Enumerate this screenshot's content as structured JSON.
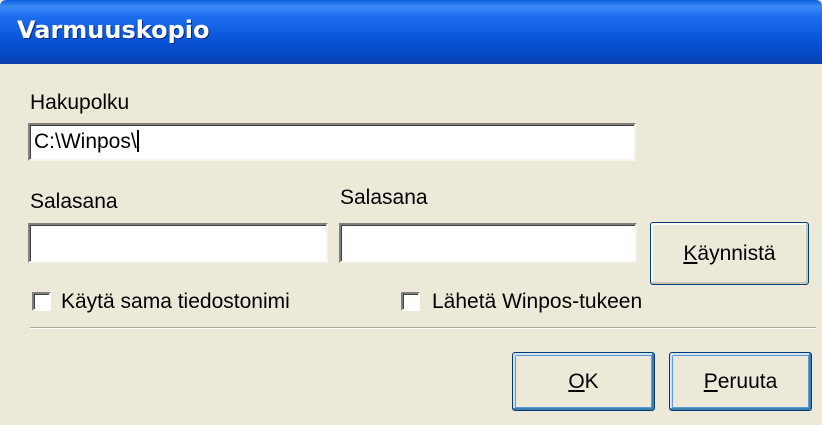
{
  "window": {
    "title": "Varmuuskopio"
  },
  "path": {
    "label": "Hakupolku",
    "value": "C:\\Winpos\\"
  },
  "password1": {
    "label": "Salasana",
    "value": ""
  },
  "password2": {
    "label": "Salasana",
    "value": ""
  },
  "start_button": {
    "mnemonic": "K",
    "rest": "äynnistä"
  },
  "checkboxes": {
    "same_filename": {
      "label": "Käytä sama tiedostonimi",
      "checked": false
    },
    "send_support": {
      "label": "Lähetä Winpos-tukeen",
      "checked": false
    }
  },
  "ok_button": {
    "mnemonic": "O",
    "rest": "K"
  },
  "cancel_button": {
    "mnemonic": "P",
    "rest": "eruuta"
  }
}
